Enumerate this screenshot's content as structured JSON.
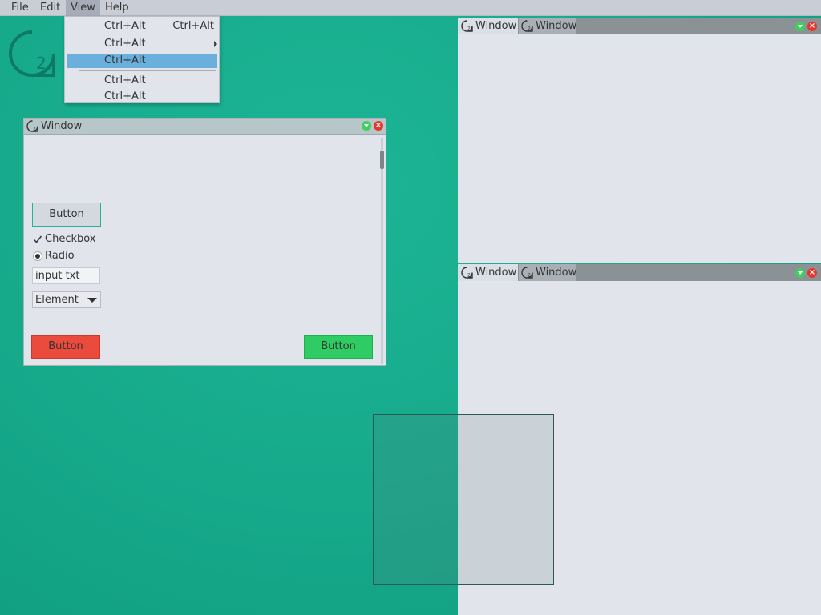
{
  "menubar": {
    "items": [
      {
        "label": "File"
      },
      {
        "label": "Edit"
      },
      {
        "label": "View"
      },
      {
        "label": "Help"
      }
    ]
  },
  "logo": {
    "text": "2"
  },
  "dropdown": {
    "items": [
      {
        "label": "Ctrl+Alt",
        "shortcut": "Ctrl+Alt"
      },
      {
        "label": "Ctrl+Alt",
        "has_submenu": true
      },
      {
        "label": "Ctrl+Alt",
        "highlighted": true
      },
      {
        "label": "Ctrl+Alt"
      },
      {
        "label": "Ctrl+Alt"
      }
    ]
  },
  "window": {
    "title": "Window",
    "button_label": "Button",
    "checkbox_label": "Checkbox",
    "checkbox_checked": true,
    "radio_label": "Radio",
    "radio_selected": true,
    "input_value": "input txt",
    "select_value": "Element",
    "red_button_label": "Button",
    "green_button_label": "Button"
  },
  "docks": [
    {
      "tabs": [
        {
          "title": "Window",
          "active": true
        },
        {
          "title": "Window",
          "active": false
        }
      ]
    },
    {
      "tabs": [
        {
          "title": "Window",
          "active": true
        },
        {
          "title": "Window",
          "active": false
        }
      ]
    }
  ],
  "colors": {
    "background": "#17ab8c",
    "accent": "#23b397",
    "highlight": "#6bb0dd",
    "danger": "#ea4b3c",
    "success": "#2ecc63"
  }
}
